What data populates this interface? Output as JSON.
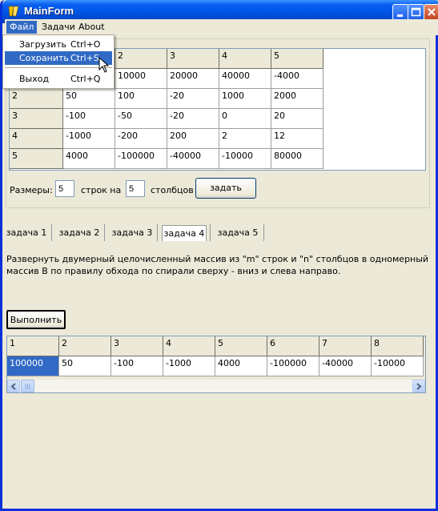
{
  "window": {
    "title": "MainForm",
    "app_icon": "delphi-icon"
  },
  "menu": {
    "items": [
      {
        "label": "Файл",
        "shortcut": ""
      },
      {
        "label": "Задачи",
        "shortcut": ""
      },
      {
        "label": "About",
        "shortcut": ""
      }
    ],
    "file_dropdown": [
      {
        "label": "Загрузить",
        "shortcut": "Ctrl+O"
      },
      {
        "label": "Сохранить",
        "shortcut": "Ctrl+S"
      },
      {
        "label": "Выход",
        "shortcut": "Ctrl+Q"
      }
    ]
  },
  "matrix": {
    "header_row": [
      "",
      "",
      "2",
      "3",
      "4",
      "5"
    ],
    "rows": [
      {
        "label": "2",
        "cells": [
          "50",
          "100",
          "-20",
          "1000",
          "2000"
        ]
      },
      {
        "label": "3",
        "cells": [
          "-100",
          "-50",
          "-20",
          "0",
          "20"
        ]
      },
      {
        "label": "4",
        "cells": [
          "-1000",
          "-200",
          "200",
          "2",
          "12"
        ]
      },
      {
        "label": "5",
        "cells": [
          "4000",
          "-100000",
          "-40000",
          "-10000",
          "80000"
        ]
      }
    ],
    "first_row_cells": [
      "10000",
      "20000",
      "40000",
      "-4000"
    ]
  },
  "size_controls": {
    "label_sizes": "Размеры:",
    "rows_value": "5",
    "label_rows": "строк на",
    "cols_value": "5",
    "label_cols": "столбцов",
    "apply_button": "задать"
  },
  "tabs": [
    "задача 1",
    "задача 2",
    "задача 3",
    "задача 4",
    "задача 5"
  ],
  "active_tab": "задача 4",
  "task_description": "Развернуть двумерный целочисленный массив из \"m\" строк и \"n\" столбцов в одномерный массив B по правилу обхода по спирали сверху - вниз и слева направо.",
  "run_button": "Выполнить",
  "result": {
    "headers": [
      "1",
      "2",
      "3",
      "4",
      "5",
      "6",
      "7",
      "8"
    ],
    "values": [
      "100000",
      "50",
      "-100",
      "-1000",
      "4000",
      "-100000",
      "-40000",
      "-10000"
    ]
  }
}
